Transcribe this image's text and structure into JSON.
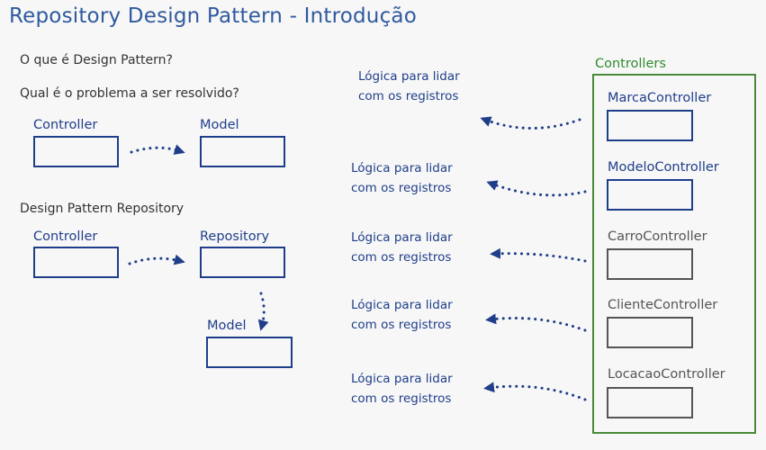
{
  "title": "Repository Design Pattern - Introdução",
  "questions": {
    "q1": "O que é Design Pattern?",
    "q2": "Qual é o problema a ser resolvido?"
  },
  "section": "Design Pattern Repository",
  "diagram1": {
    "controller": "Controller",
    "model": "Model"
  },
  "diagram2": {
    "controller": "Controller",
    "repository": "Repository",
    "model": "Model"
  },
  "controllers_group": {
    "label": "Controllers",
    "items": [
      "MarcaController",
      "ModeloController",
      "CarroController",
      "ClienteController",
      "LocacaoController"
    ]
  },
  "logic_notes": [
    {
      "line1": "Lógica para lidar",
      "line2": "com os registros"
    },
    {
      "line1": "Lógica para lidar",
      "line2": "com os registros"
    },
    {
      "line1": "Lógica para lidar",
      "line2": "com os registros"
    },
    {
      "line1": "Lógica para lidar",
      "line2": "com os registros"
    },
    {
      "line1": "Lógica para lidar",
      "line2": "com os registros"
    }
  ],
  "colors": {
    "blue": "#1f3e8a",
    "green": "#4a8a3a",
    "gray": "#555555",
    "title": "#2f5a9e"
  }
}
